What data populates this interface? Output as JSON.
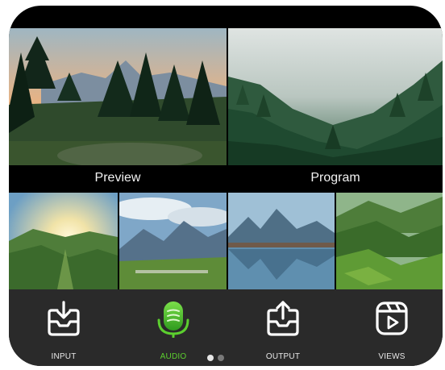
{
  "screen": {
    "preview_label": "Preview",
    "program_label": "Program"
  },
  "thumbnails": [
    {
      "scene": "sunrise-green-valley"
    },
    {
      "scene": "mountain-meadow-sheep"
    },
    {
      "scene": "alpine-lake-reflection"
    },
    {
      "scene": "green-hills-terraces"
    }
  ],
  "toolbar": {
    "items": [
      {
        "label": "INPUT",
        "icon": "inbox-download-icon",
        "active": false
      },
      {
        "label": "AUDIO",
        "icon": "microphone-icon",
        "active": true
      },
      {
        "label": "OUTPUT",
        "icon": "inbox-upload-icon",
        "active": false
      },
      {
        "label": "VIEWS",
        "icon": "video-reel-icon",
        "active": false
      }
    ],
    "accent_color": "#5ccf2f"
  },
  "pager": {
    "page_count": 2,
    "current_page": 1,
    "active_color": "#e6e6e6",
    "inactive_color": "#7a7a7a"
  }
}
